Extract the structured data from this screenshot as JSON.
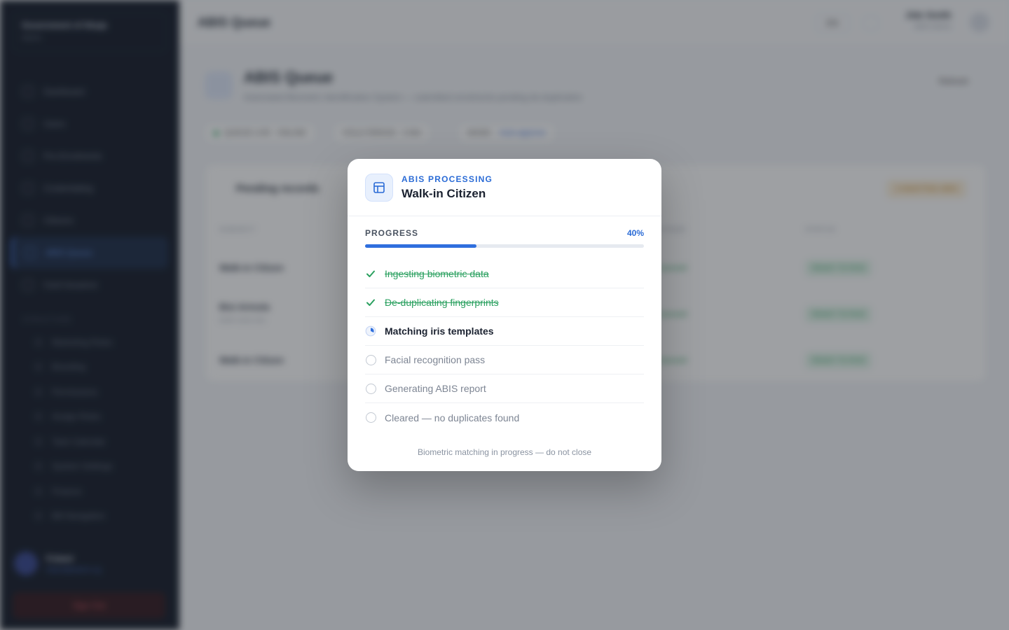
{
  "background": {
    "org": {
      "name": "Government of Abuja",
      "sub": "Admin"
    },
    "nav": [
      {
        "label": "Dashboard",
        "active": false
      },
      {
        "label": "Users",
        "active": false
      },
      {
        "label": "Pre-Enrolments",
        "active": false
      },
      {
        "label": "Credentialing",
        "active": false
      },
      {
        "label": "Citizens",
        "active": false
      },
      {
        "label": "ABIS Queue",
        "active": true
      },
      {
        "label": "Card Issuance",
        "active": false
      }
    ],
    "section_label": "STRUCTURE",
    "sub_nav": [
      "Marketing Roles",
      "Branding",
      "Permissions",
      "Assign Roles",
      "Task Calendar",
      "System Settings",
      "Finance",
      "Bill Navigation"
    ],
    "user": {
      "name": "Folami",
      "email": "folami@admin.ng"
    },
    "signout_label": "Sign Out",
    "topbar": {
      "title": "ABIS Queue",
      "lang": "EN",
      "user_name": "Jide Smith",
      "user_role": "ABIS Admin"
    },
    "page": {
      "title": "ABIS Queue",
      "subtitle": "Automated Biometric Identification System — submitted enrolments pending de-duplication",
      "refresh_label": "Refresh",
      "chips": [
        {
          "label": "QUEUE LIVE · ONLINE",
          "link": ""
        },
        {
          "label": "HOLD PERIOD · 3 Min",
          "link": ""
        },
        {
          "label": "MODE ·",
          "link": "Auto-approve"
        }
      ],
      "card_title": "Pending records",
      "card_badge": "3 AWAITING ABIS",
      "headers": [
        "SUBJECT",
        "STAGE",
        "STATUS"
      ],
      "rows": [
        {
          "name": "Walk-in Citizen",
          "sub": "",
          "stage": "Queued",
          "status": "READY TO RUN"
        },
        {
          "name": "Bisi Arinola",
          "sub": "ENR-1042-201",
          "stage": "Queued",
          "status": "READY TO RUN"
        },
        {
          "name": "Walk-in Citizen",
          "sub": "",
          "stage": "Queued",
          "status": "READY TO RUN"
        }
      ]
    }
  },
  "modal": {
    "kicker": "ABIS PROCESSING",
    "title": "Walk-in Citizen",
    "progress_label": "PROGRESS",
    "progress_text": "40%",
    "progress_fraction": 0.4,
    "steps": [
      {
        "label": "Ingesting biometric data",
        "state": "done"
      },
      {
        "label": "De-duplicating fingerprints",
        "state": "done"
      },
      {
        "label": "Matching iris templates",
        "state": "active"
      },
      {
        "label": "Facial recognition pass",
        "state": "pending"
      },
      {
        "label": "Generating ABIS report",
        "state": "pending"
      },
      {
        "label": "Cleared — no duplicates found",
        "state": "pending"
      }
    ],
    "footer": "Biometric matching in progress — do not close"
  },
  "colors": {
    "accent": "#2f6fde",
    "success": "#2aa05f",
    "sidebar": "#0b1220"
  }
}
